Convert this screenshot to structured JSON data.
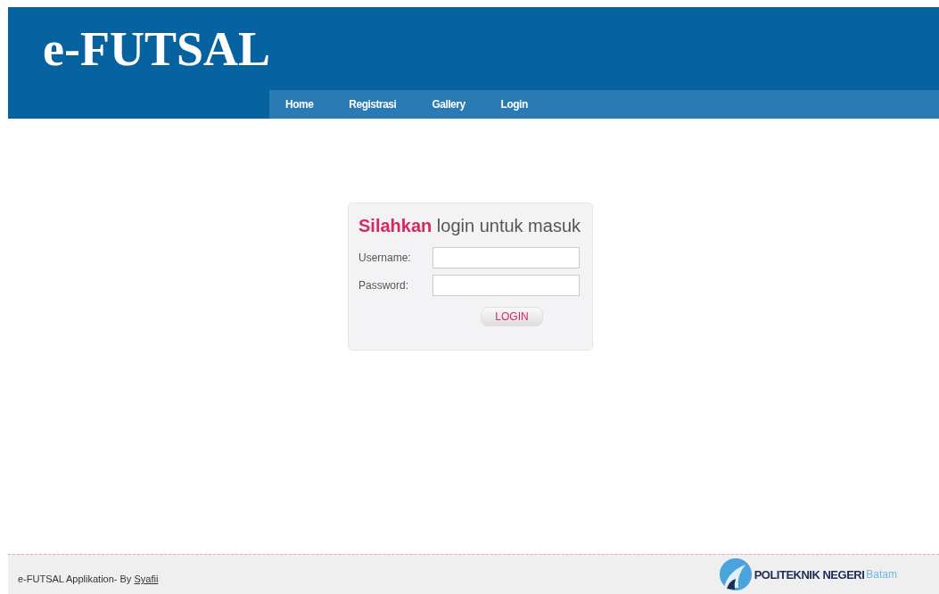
{
  "header": {
    "logo": "e-FUTSAL"
  },
  "nav": [
    {
      "label": "Home"
    },
    {
      "label": "Registrasi"
    },
    {
      "label": "Gallery"
    },
    {
      "label": "Login"
    }
  ],
  "login": {
    "heading": "**Silahkan** login untuk masuk",
    "fields": [
      {
        "label": "Username:"
      },
      {
        "label": "Password:"
      }
    ],
    "button": "LOGIN"
  },
  "footer": {
    "text": "e-FUTSAL Applikation- By",
    "author": "Syafii",
    "brand": "POLITEKNIK NEGERI",
    "brand_city": "Batam"
  }
}
